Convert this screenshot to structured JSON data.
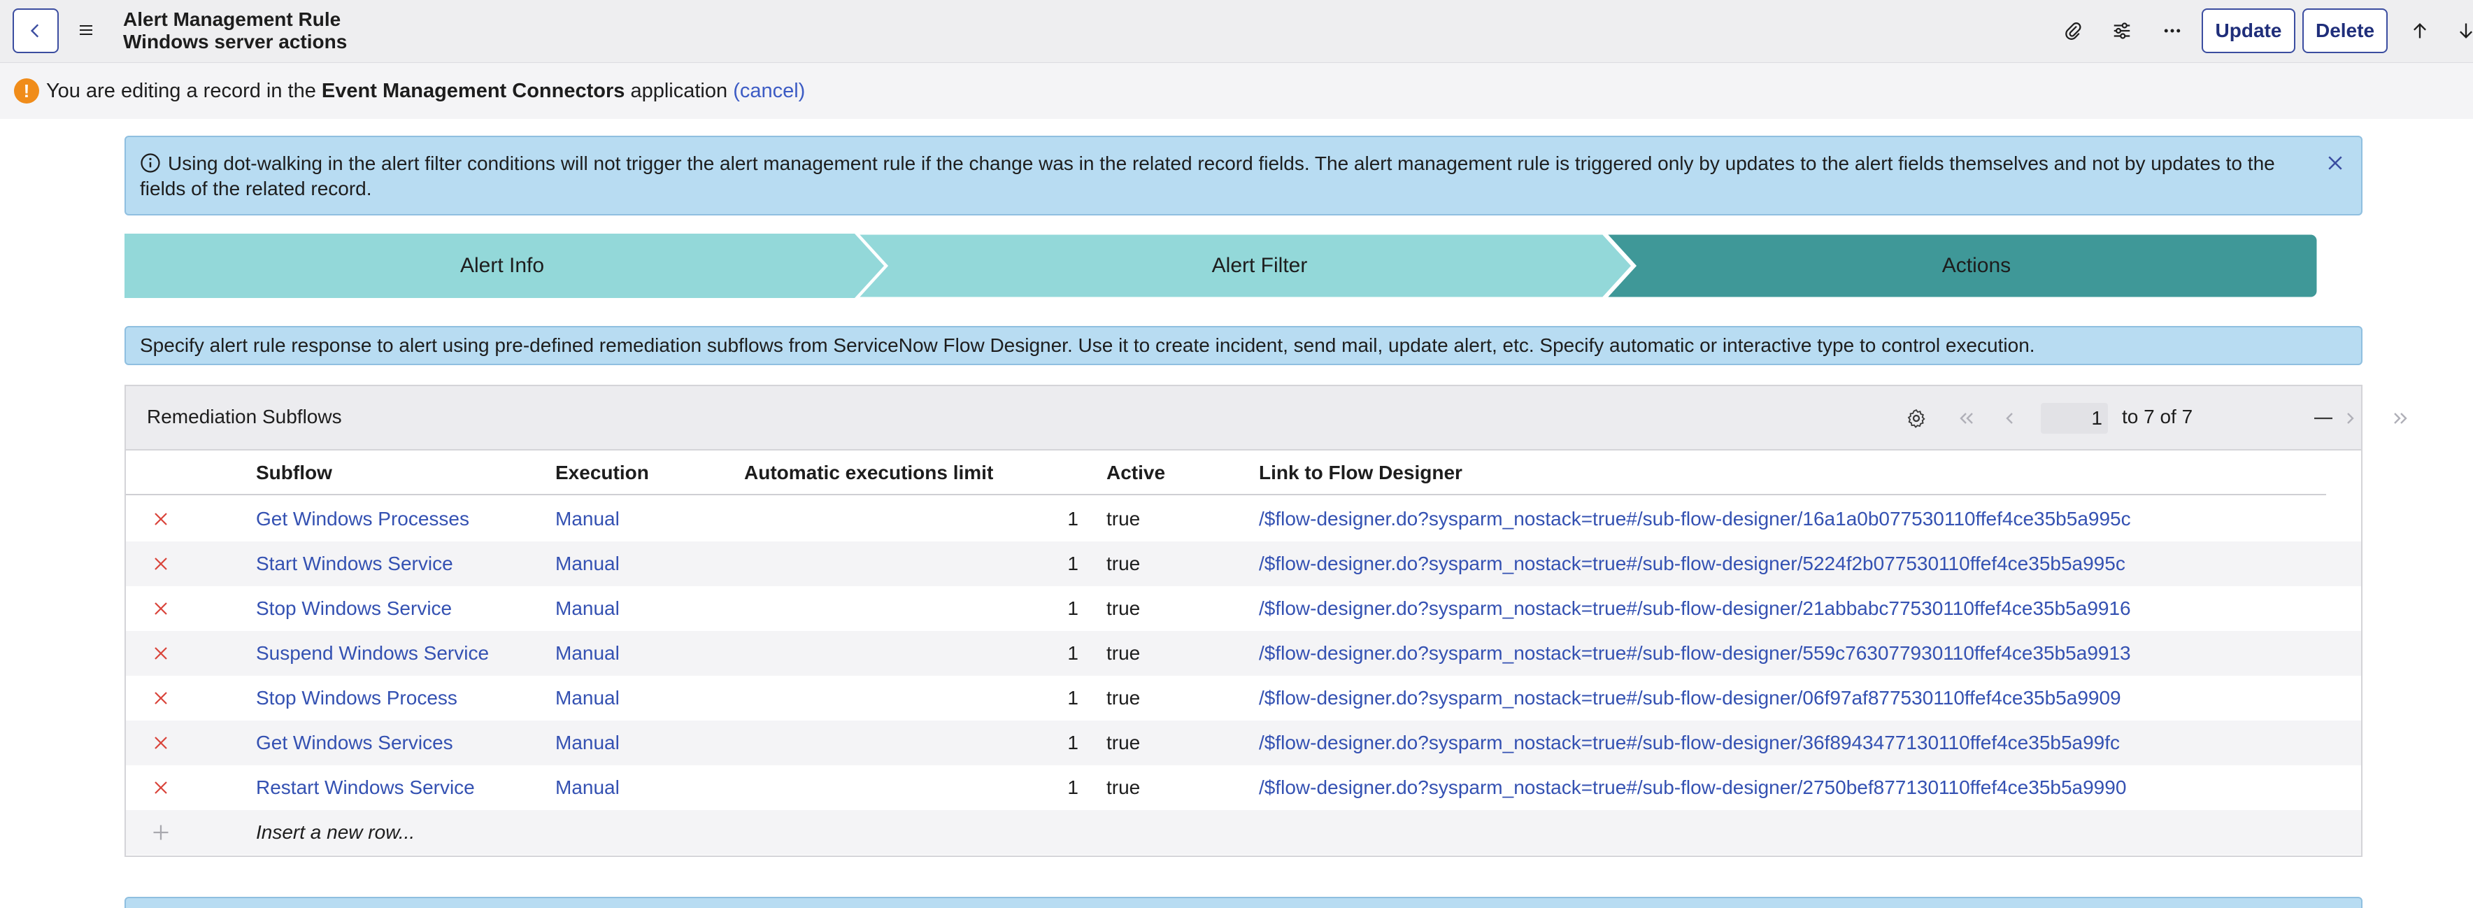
{
  "header": {
    "title": "Alert Management Rule",
    "subtitle": "Windows server actions",
    "update_label": "Update",
    "delete_label": "Delete"
  },
  "edit_banner": {
    "prefix": "You are editing a record in the ",
    "app_name": "Event Management Connectors",
    "suffix": " application ",
    "cancel": "(cancel)"
  },
  "info_banner": {
    "text": "Using dot-walking in the alert filter conditions will not trigger the alert management rule if the change was in the related record fields. The alert management rule is triggered only by updates to the alert fields themselves and not by updates to the fields of the related record."
  },
  "steps": [
    {
      "label": "Alert Info",
      "state": "done"
    },
    {
      "label": "Alert Filter",
      "state": "done"
    },
    {
      "label": "Actions",
      "state": "active"
    }
  ],
  "hint": {
    "text": "Specify alert rule response to alert using pre-defined remediation subflows from ServiceNow Flow Designer. Use it to create incident, send mail, update alert, etc. Specify automatic or interactive type to control execution."
  },
  "related_list": {
    "title": "Remediation Subflows",
    "page_input": "1",
    "page_text": "to 7 of 7",
    "columns": [
      "Subflow",
      "Execution",
      "Automatic executions limit",
      "Active",
      "Link to Flow Designer"
    ],
    "rows": [
      {
        "subflow": "Get Windows Processes",
        "execution": "Manual",
        "limit": "1",
        "active": "true",
        "link": "/$flow-designer.do?sysparm_nostack=true#/sub-flow-designer/16a1a0b077530110ffef4ce35b5a995c"
      },
      {
        "subflow": "Start Windows Service",
        "execution": "Manual",
        "limit": "1",
        "active": "true",
        "link": "/$flow-designer.do?sysparm_nostack=true#/sub-flow-designer/5224f2b077530110ffef4ce35b5a995c"
      },
      {
        "subflow": "Stop Windows Service",
        "execution": "Manual",
        "limit": "1",
        "active": "true",
        "link": "/$flow-designer.do?sysparm_nostack=true#/sub-flow-designer/21abbabc77530110ffef4ce35b5a9916"
      },
      {
        "subflow": "Suspend Windows Service",
        "execution": "Manual",
        "limit": "1",
        "active": "true",
        "link": "/$flow-designer.do?sysparm_nostack=true#/sub-flow-designer/559c763077930110ffef4ce35b5a9913"
      },
      {
        "subflow": "Stop Windows Process",
        "execution": "Manual",
        "limit": "1",
        "active": "true",
        "link": "/$flow-designer.do?sysparm_nostack=true#/sub-flow-designer/06f97af877530110ffef4ce35b5a9909"
      },
      {
        "subflow": "Get Windows Services",
        "execution": "Manual",
        "limit": "1",
        "active": "true",
        "link": "/$flow-designer.do?sysparm_nostack=true#/sub-flow-designer/36f8943477130110ffef4ce35b5a99fc"
      },
      {
        "subflow": "Restart Windows Service",
        "execution": "Manual",
        "limit": "1",
        "active": "true",
        "link": "/$flow-designer.do?sysparm_nostack=true#/sub-flow-designer/2750bef877130110ffef4ce35b5a9990"
      }
    ],
    "insert_label": "Insert a new row..."
  },
  "icons": {
    "back": "chevron-left-icon",
    "menu": "hamburger-menu-icon",
    "attach": "paperclip-icon",
    "personalize": "sliders-icon",
    "more": "ellipsis-icon",
    "prev_record": "arrow-up-icon",
    "next_record": "arrow-down-icon",
    "warning": "warning-icon",
    "info": "info-icon",
    "close": "close-icon",
    "gear": "gear-icon",
    "delete_row": "x-icon",
    "insert": "plus-icon"
  },
  "colors": {
    "accent": "#3b4da0",
    "link": "#3451b2",
    "step_done": "#93d8d9",
    "step_active": "#3f9898",
    "banner_bg": "#b8dcf2",
    "warning": "#f08c1a",
    "delete_x": "#d9443a"
  }
}
